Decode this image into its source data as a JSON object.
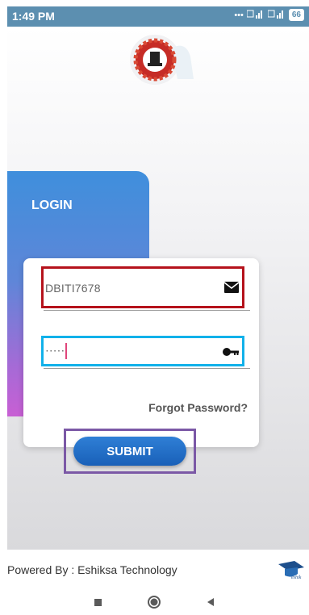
{
  "status_bar": {
    "time": "1:49 PM",
    "icons": [
      "dots-icon",
      "volte-icon",
      "signal-icon",
      "volte2-icon",
      "4g-signal-icon"
    ],
    "battery": "66"
  },
  "login": {
    "title": "LOGIN",
    "username_value": "DBITI7678",
    "password_value": "·····",
    "forgot_label": "Forgot Password?",
    "submit_label": "SUBMIT"
  },
  "footer": {
    "powered_by": "Powered By : Eshiksa Technology",
    "footer_logo_text": "eshik"
  },
  "colors": {
    "status_bar": "#5c8fb0",
    "username_highlight": "#b5121b",
    "password_highlight": "#11b1ea",
    "submit_highlight": "#7b58a6",
    "submit_button": "#1960b8"
  }
}
